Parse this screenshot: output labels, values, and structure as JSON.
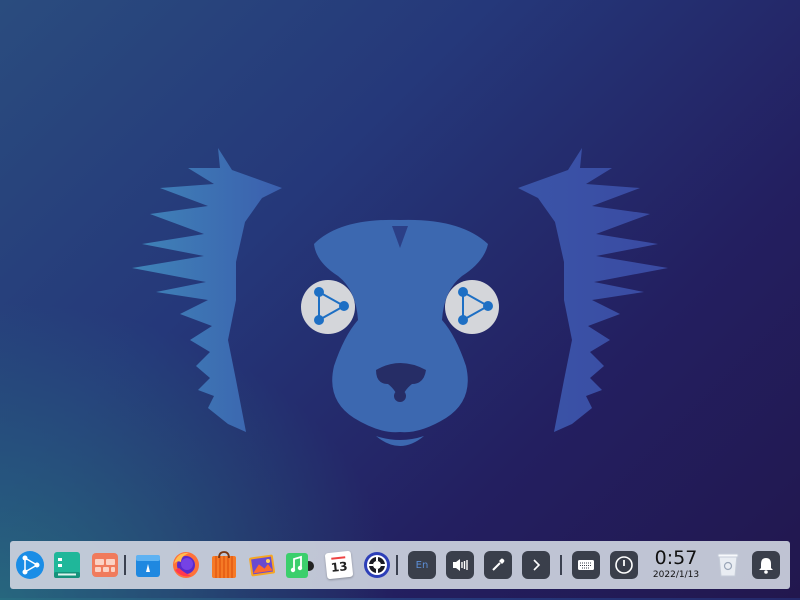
{
  "dock": {
    "apps": [
      {
        "name": "launcher-icon",
        "label": ""
      },
      {
        "name": "file-manager-icon",
        "label": ""
      },
      {
        "name": "multitask-view-icon",
        "label": ""
      },
      {
        "name": "app-store-icon",
        "label": ""
      },
      {
        "name": "firefox-icon",
        "label": ""
      },
      {
        "name": "app-store-bag-icon",
        "label": ""
      },
      {
        "name": "image-viewer-icon",
        "label": ""
      },
      {
        "name": "music-icon",
        "label": ""
      },
      {
        "name": "calendar-icon",
        "label": ""
      },
      {
        "name": "settings-icon",
        "label": ""
      }
    ],
    "calendar_day": "13",
    "input_method": "En",
    "clock": {
      "time": "0:57",
      "date": "2022/1/13"
    }
  },
  "colors": {
    "dock_bg": "#cdd2de",
    "tray_bg": "#3a3f4b",
    "wallpaper_shape": "#3d6fb0"
  }
}
